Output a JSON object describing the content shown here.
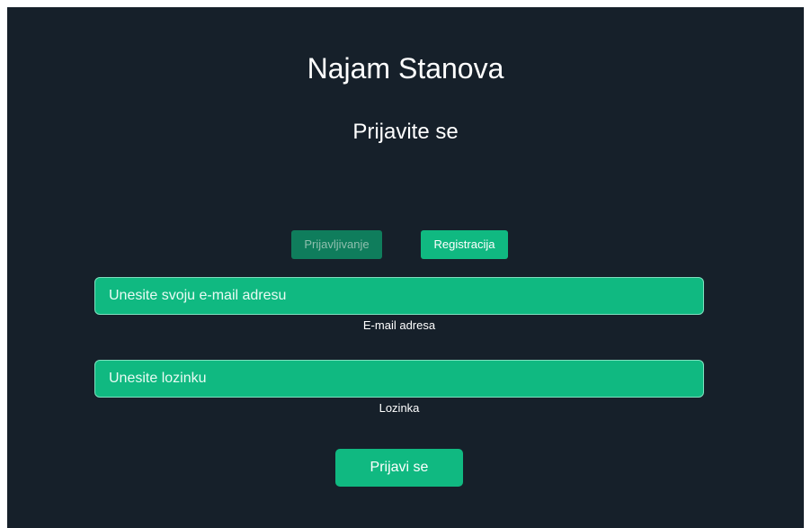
{
  "app": {
    "title": "Najam Stanova",
    "subtitle": "Prijavite se"
  },
  "mode_switch": {
    "login_label": "Prijavljivanje",
    "register_label": "Registracija",
    "active": "login"
  },
  "form": {
    "email": {
      "value": "",
      "placeholder": "Unesite svoju e-mail adresu",
      "label": "E-mail adresa"
    },
    "password": {
      "value": "",
      "placeholder": "Unesite lozinku",
      "label": "Lozinka"
    },
    "submit_label": "Prijavi se"
  },
  "colors": {
    "background": "#16202a",
    "accent": "#10b981",
    "accent_dim": "#0f7d5c",
    "text": "#ffffff"
  }
}
